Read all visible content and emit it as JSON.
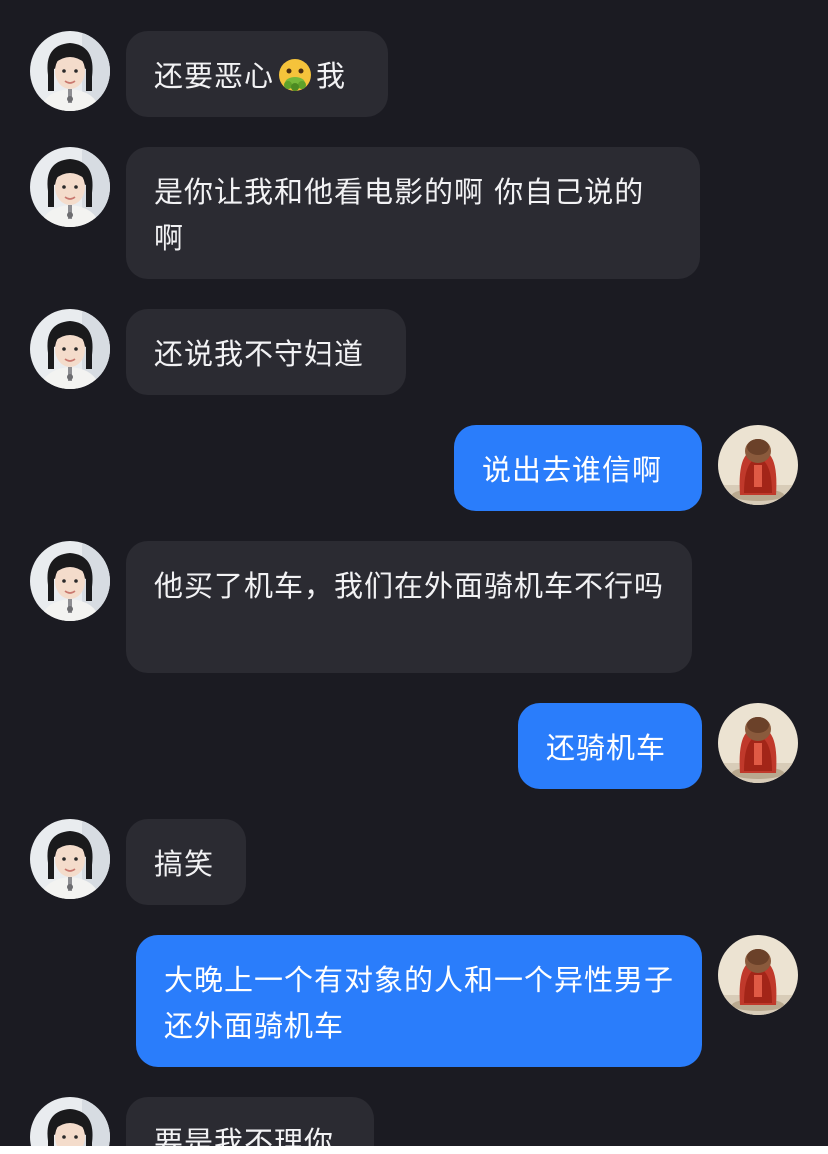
{
  "messages": [
    {
      "side": "in",
      "parts": [
        "还要恶心",
        "我"
      ],
      "emoji": "nauseated-face"
    },
    {
      "side": "in",
      "text": "是你让我和他看电影的啊 你自己说的啊"
    },
    {
      "side": "in",
      "text": "还说我不守妇道"
    },
    {
      "side": "out",
      "text": "说出去谁信啊"
    },
    {
      "side": "in",
      "text": "他买了机车，我们在外面骑机车不行吗"
    },
    {
      "side": "out",
      "text": "还骑机车"
    },
    {
      "side": "in",
      "text": "搞笑"
    },
    {
      "side": "out",
      "text": "大晚上一个有对象的人和一个异性男子还外面骑机车"
    },
    {
      "side": "in",
      "text": "要是我不理你"
    }
  ],
  "colors": {
    "background": "#1b1b22",
    "incoming_bubble": "#2b2b32",
    "outgoing_bubble": "#2a7dfb"
  },
  "icons": {
    "contact_avatar": "woman-portrait-avatar",
    "self_avatar": "red-robed-figurine-avatar",
    "emoji": "nauseated-face-emoji"
  }
}
